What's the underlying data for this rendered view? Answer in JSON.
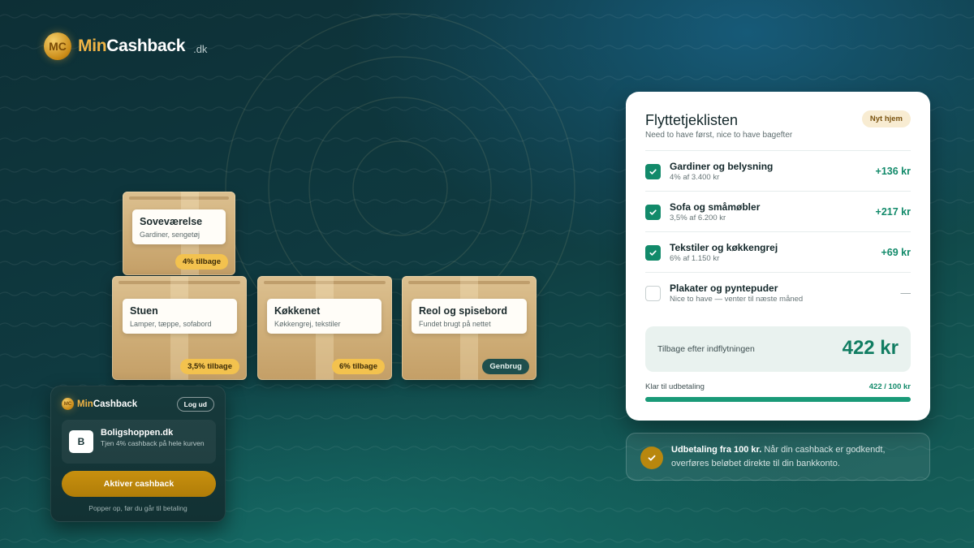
{
  "brand": {
    "coin_mark": "MC",
    "name_part1": "Min",
    "name_part2": "Cashback",
    "tld": ".dk"
  },
  "boxes": [
    {
      "title": "Soveværelse",
      "subtitle": "Gardiner, sengetøj",
      "badge": "4% tilbage"
    },
    {
      "title": "Stuen",
      "subtitle": "Lamper, tæppe, sofabord",
      "badge": "3,5% tilbage"
    },
    {
      "title": "Køkkenet",
      "subtitle": "Køkkengrej, tekstiler",
      "badge": "6% tilbage"
    },
    {
      "title": "Reol og spisebord",
      "subtitle": "Fundet brugt på nettet",
      "badge": "Genbrug"
    }
  ],
  "popup": {
    "brand_part1": "Min",
    "brand_part2": "Cashback",
    "logout_label": "Log ud",
    "shop_initial": "B",
    "shop_name": "Boligshoppen.dk",
    "shop_desc": "Tjen 4% cashback på hele kurven",
    "activate_label": "Aktiver cashback",
    "note": "Popper op, før du går til betaling"
  },
  "checklist": {
    "title": "Flyttetjeklisten",
    "subtitle": "Need to have først, nice to have bagefter",
    "badge": "Nyt hjem",
    "items": [
      {
        "title": "Gardiner og belysning",
        "detail": "4% af 3.400 kr",
        "value": "+136 kr",
        "checked": true
      },
      {
        "title": "Sofa og småmøbler",
        "detail": "3,5% af 6.200 kr",
        "value": "+217 kr",
        "checked": true
      },
      {
        "title": "Tekstiler og køkkengrej",
        "detail": "6% af 1.150 kr",
        "value": "+69 kr",
        "checked": true
      },
      {
        "title": "Plakater og pyntepuder",
        "detail": "Nice to have — venter til næste måned",
        "value": "—",
        "checked": false
      }
    ],
    "total_label": "Tilbage efter indflytningen",
    "total_value": "422 kr",
    "ready_label": "Klar til udbetaling",
    "ready_value": "422 / 100 kr",
    "progress": 1.0
  },
  "info": {
    "bold": "Udbetaling fra 100 kr.",
    "text": " Når din cashback er godkendt, overføres beløbet direkte til din bankkonto."
  },
  "colors": {
    "accent_green": "#128a6a",
    "gold": "#f0b445",
    "badge_yellow": "#f3c24e"
  }
}
